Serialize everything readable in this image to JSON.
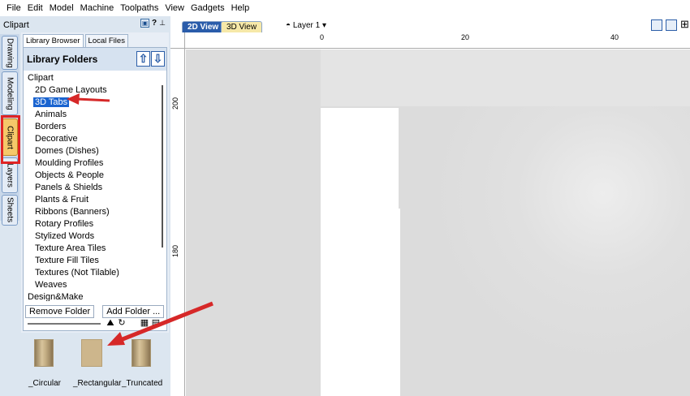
{
  "menu": [
    "File",
    "Edit",
    "Model",
    "Machine",
    "Toolpaths",
    "View",
    "Gadgets",
    "Help"
  ],
  "panel": {
    "title": "Clipart",
    "help": "?",
    "vertical_tabs": [
      "Drawing",
      "Modeling",
      "Clipart",
      "Layers",
      "Sheets"
    ],
    "active_vertical_tab": "Clipart",
    "inner_tabs": [
      "Library Browser",
      "Local Files"
    ],
    "library_header": "Library Folders",
    "tree": [
      {
        "label": "Clipart",
        "level": 0
      },
      {
        "label": "2D Game Layouts",
        "level": 1
      },
      {
        "label": "3D Tabs",
        "level": 1,
        "selected": true
      },
      {
        "label": "Animals",
        "level": 1
      },
      {
        "label": "Borders",
        "level": 1
      },
      {
        "label": "Decorative",
        "level": 1
      },
      {
        "label": "Domes (Dishes)",
        "level": 1
      },
      {
        "label": "Moulding Profiles",
        "level": 1
      },
      {
        "label": "Objects & People",
        "level": 1
      },
      {
        "label": "Panels & Shields",
        "level": 1
      },
      {
        "label": "Plants & Fruit",
        "level": 1
      },
      {
        "label": "Ribbons (Banners)",
        "level": 1
      },
      {
        "label": "Rotary Profiles",
        "level": 1
      },
      {
        "label": "Stylized Words",
        "level": 1
      },
      {
        "label": "Texture Area Tiles",
        "level": 1
      },
      {
        "label": "Texture Fill Tiles",
        "level": 1
      },
      {
        "label": "Textures (Not Tilable)",
        "level": 1
      },
      {
        "label": "Weaves",
        "level": 1
      },
      {
        "label": "Design&Make",
        "level": 0
      }
    ],
    "buttons": {
      "remove": "Remove Folder",
      "add": "Add Folder ..."
    },
    "thumbnails": [
      "_Circular",
      "_Rectangular",
      "_Truncated"
    ]
  },
  "view": {
    "tabs": [
      "2D View",
      "3D View"
    ],
    "active_tab": "2D View",
    "layer": "Layer 1",
    "ruler_top": [
      "0",
      "20",
      "40"
    ],
    "ruler_left": [
      "200",
      "180"
    ]
  },
  "colors": {
    "accent": "#2a5caa",
    "highlight": "#1a64d0",
    "annotation": "#e02424"
  }
}
